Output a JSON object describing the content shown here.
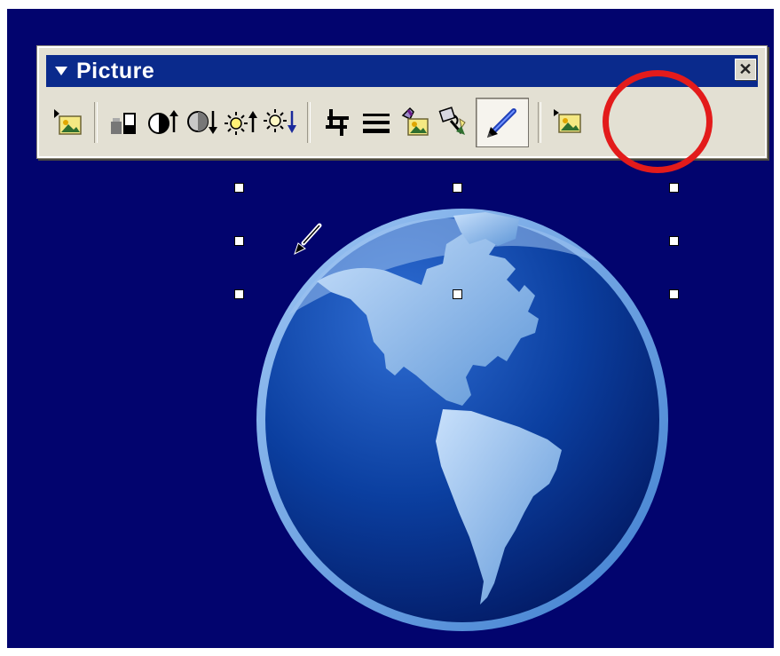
{
  "toolbar": {
    "title": "Picture",
    "close_glyph": "✕",
    "buttons": [
      {
        "name": "insert-picture-button",
        "icon": "picture-icon"
      },
      {
        "name": "color-button",
        "icon": "color-mode-icon"
      },
      {
        "name": "more-contrast-button",
        "icon": "contrast-up-icon"
      },
      {
        "name": "less-contrast-button",
        "icon": "contrast-down-icon"
      },
      {
        "name": "more-brightness-button",
        "icon": "brightness-up-icon"
      },
      {
        "name": "less-brightness-button",
        "icon": "brightness-down-icon"
      },
      {
        "name": "crop-button",
        "icon": "crop-icon"
      },
      {
        "name": "line-style-button",
        "icon": "line-style-icon"
      },
      {
        "name": "format-picture-button",
        "icon": "format-picture-icon"
      },
      {
        "name": "set-transparent-color-button",
        "icon": "magic-wand-icon"
      },
      {
        "name": "recolor-picture-button",
        "icon": "pencil-icon",
        "pressed": true
      },
      {
        "name": "reset-picture-button",
        "icon": "reset-picture-icon"
      }
    ]
  },
  "colors": {
    "background": "#02046e",
    "titlebar": "#0a2a8c",
    "highlight": "#e31b1b",
    "globe_ocean": "#0b3fa0",
    "globe_land": "#7bb0e6",
    "globe_rim": "#5c9be0"
  }
}
